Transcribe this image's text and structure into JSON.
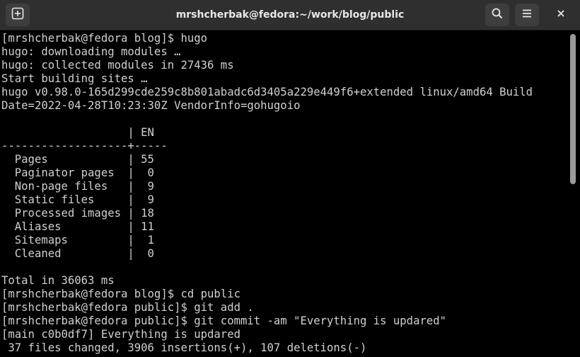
{
  "window": {
    "title": "mrshcherbak@fedora:~/work/blog/public"
  },
  "header": {
    "icons": {
      "new_tab": "new-tab-icon",
      "search": "search-icon",
      "menu": "hamburger-menu-icon",
      "close": "close-icon"
    }
  },
  "terminal": {
    "lines": [
      "[mrshcherbak@fedora blog]$ hugo",
      "hugo: downloading modules …",
      "hugo: collected modules in 27436 ms",
      "Start building sites …",
      "hugo v0.98.0-165d299cde259c8b801abadc6d3405a229e449f6+extended linux/amd64 Build",
      "Date=2022-04-28T10:23:30Z VendorInfo=gohugoio",
      "",
      "                   | EN",
      "-------------------+-----",
      "  Pages            | 55",
      "  Paginator pages  |  0",
      "  Non-page files   |  9",
      "  Static files     |  9",
      "  Processed images | 18",
      "  Aliases          | 11",
      "  Sitemaps         |  1",
      "  Cleaned          |  0",
      "",
      "Total in 36063 ms",
      "[mrshcherbak@fedora blog]$ cd public",
      "[mrshcherbak@fedora public]$ git add .",
      "[mrshcherbak@fedora public]$ git commit -am \"Everything is updared\"",
      "[main c0b0df7] Everything is updared",
      " 37 files changed, 3906 insertions(+), 107 deletions(-)"
    ]
  },
  "colors": {
    "titlebar_bg": "#2f2f2f",
    "terminal_bg": "#000000",
    "terminal_fg": "#d0d0d0",
    "button_bg": "#3e3e3e"
  }
}
